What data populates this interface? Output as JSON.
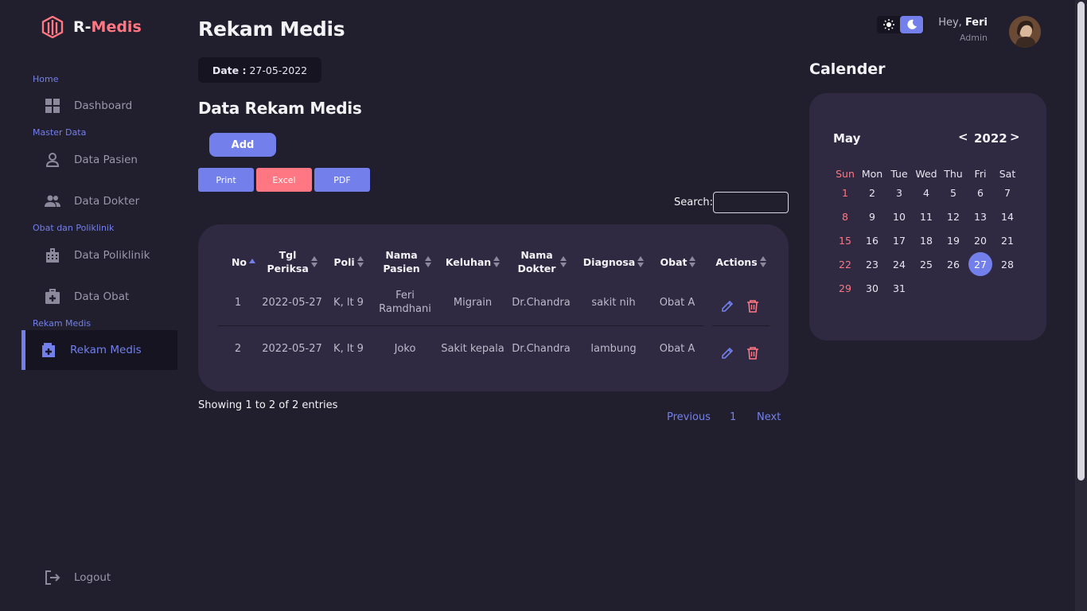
{
  "brand": {
    "prefix": "R-",
    "name": "Medis",
    "logo_icon": "hexagon-logo-icon"
  },
  "sidebar": {
    "sections": [
      {
        "label": "Home"
      },
      {
        "label": "Master Data"
      },
      {
        "label": "Obat dan Poliklinik"
      },
      {
        "label": "Rekam Medis"
      }
    ],
    "items": [
      {
        "label": "Dashboard",
        "icon": "grid-icon"
      },
      {
        "label": "Data Pasien",
        "icon": "person-icon"
      },
      {
        "label": "Data Dokter",
        "icon": "people-icon"
      },
      {
        "label": "Data Poliklinik",
        "icon": "building-icon"
      },
      {
        "label": "Data Obat",
        "icon": "medkit-icon"
      },
      {
        "label": "Rekam Medis",
        "icon": "medical-record-icon",
        "active": true
      }
    ],
    "logout": {
      "label": "Logout",
      "icon": "logout-icon"
    }
  },
  "header": {
    "title": "Rekam Medis",
    "date_label": "Date :",
    "date_value": "27-05-2022",
    "greeting_prefix": "Hey,",
    "user_name": "Feri",
    "user_role": "Admin"
  },
  "main": {
    "section_title": "Data Rekam Medis",
    "buttons": {
      "add": "Add",
      "print": "Print",
      "excel": "Excel",
      "pdf": "PDF"
    },
    "search_label": "Search:",
    "search_value": "",
    "table": {
      "headers": [
        "No",
        "Tgl Periksa",
        "Poli",
        "Nama Pasien",
        "Keluhan",
        "Nama Dokter",
        "Diagnosa",
        "Obat",
        "Actions"
      ],
      "rows": [
        [
          "1",
          "2022-05-27",
          "K, lt 9",
          "Feri Ramdhani",
          "Migrain",
          "Dr.Chandra",
          "sakit nih",
          "Obat A"
        ],
        [
          "2",
          "2022-05-27",
          "K, lt 9",
          "Joko",
          "Sakit kepala",
          "Dr.Chandra",
          "lambung",
          "Obat A"
        ]
      ]
    },
    "showing": "Showing 1 to 2 of 2 entries",
    "pager": {
      "previous": "Previous",
      "page": "1",
      "next": "Next"
    }
  },
  "calendar": {
    "title": "Calender",
    "month": "May",
    "year": "2022",
    "prev": "<",
    "next": ">",
    "weekdays": [
      "Sun",
      "Mon",
      "Tue",
      "Wed",
      "Thu",
      "Fri",
      "Sat"
    ],
    "days": [
      [
        "1",
        "2",
        "3",
        "4",
        "5",
        "6",
        "7"
      ],
      [
        "8",
        "9",
        "10",
        "11",
        "12",
        "13",
        "14"
      ],
      [
        "15",
        "16",
        "17",
        "18",
        "19",
        "20",
        "21"
      ],
      [
        "22",
        "23",
        "24",
        "25",
        "26",
        "27",
        "28"
      ],
      [
        "29",
        "30",
        "31"
      ]
    ],
    "today": "27"
  },
  "colors": {
    "primary": "#7380ec",
    "danger": "#ff7782",
    "background": "#211e2d",
    "card": "#2f2a42"
  }
}
